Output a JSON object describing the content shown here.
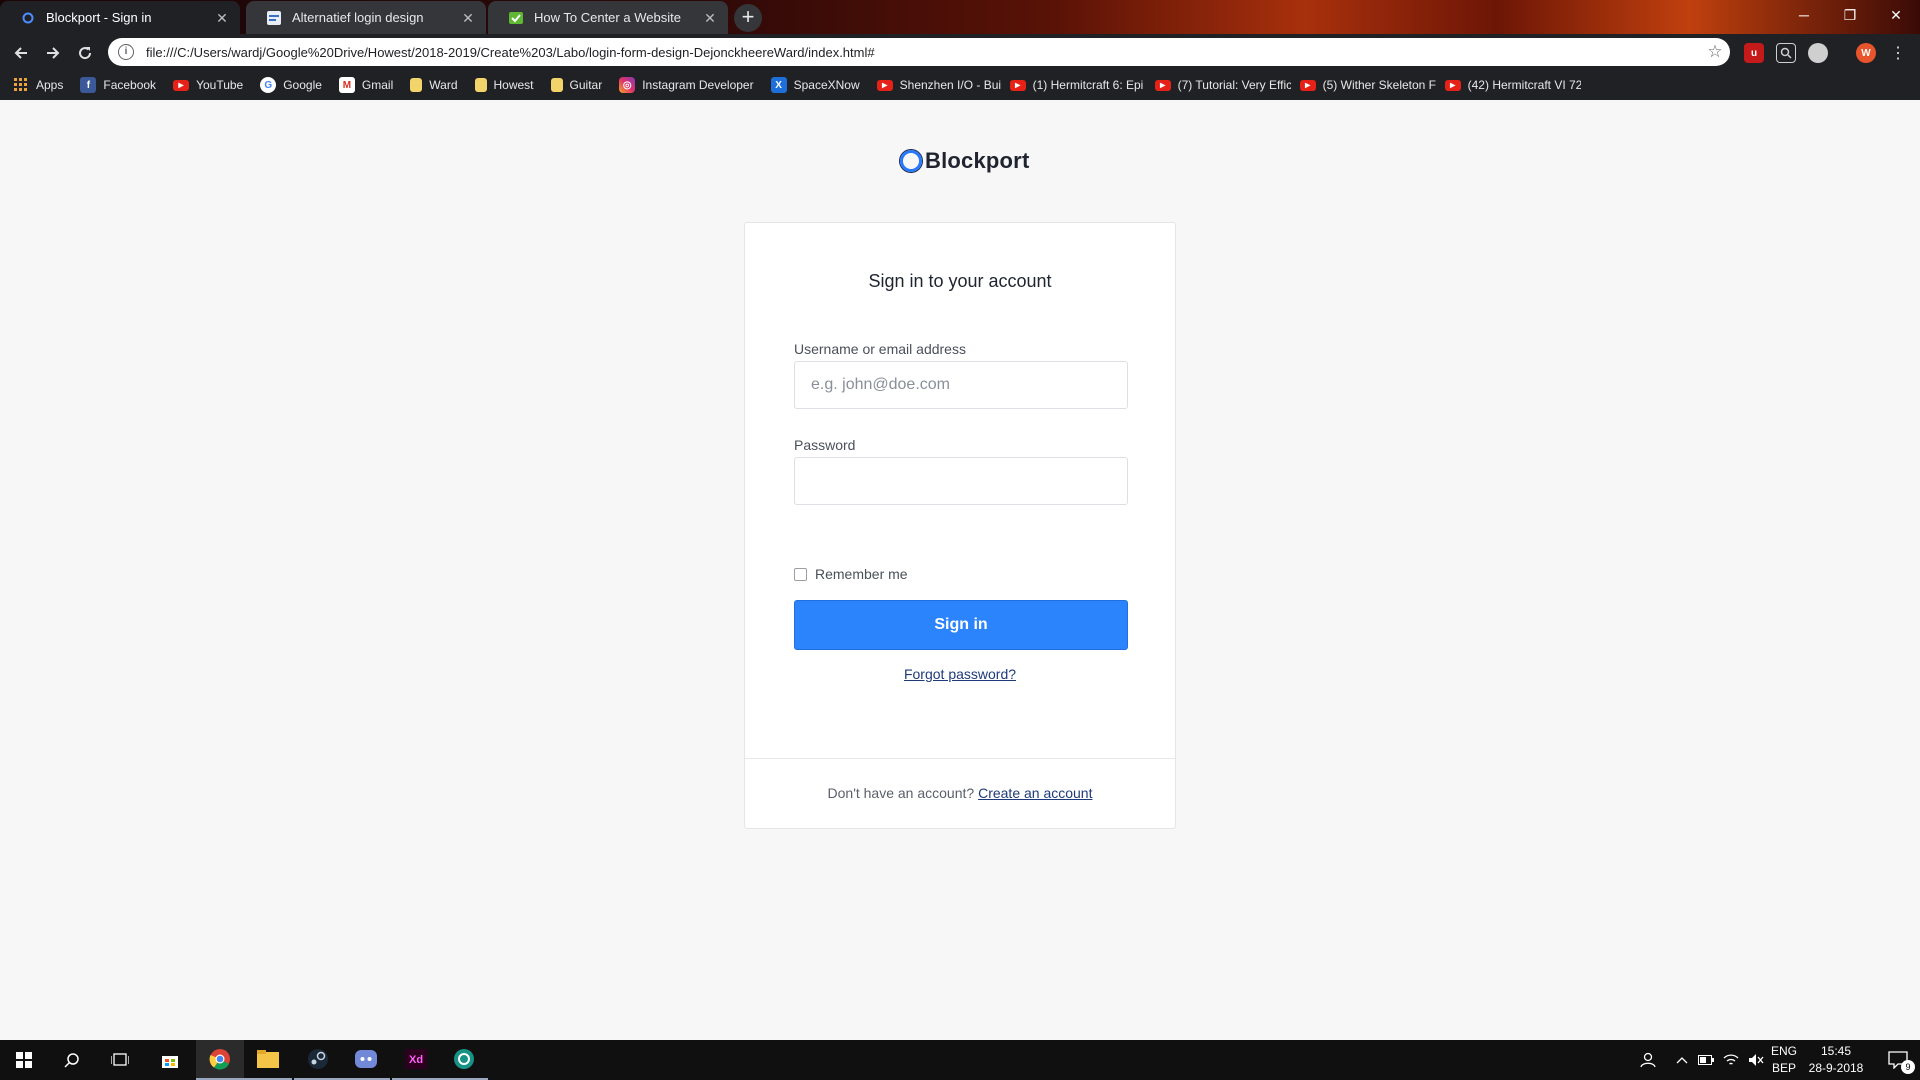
{
  "browser": {
    "tabs": [
      {
        "title": "Blockport - Sign in",
        "active": true
      },
      {
        "title": "Alternatief login design",
        "active": false
      },
      {
        "title": "How To Center a Website",
        "active": false
      }
    ],
    "url": "file:///C:/Users/wardj/Google%20Drive/Howest/2018-2019/Create%203/Labo/login-form-design-DejonckheereWard/index.html#",
    "bookmarks": [
      {
        "label": "Apps",
        "icon": "apps-grid-icon"
      },
      {
        "label": "Facebook",
        "icon": "facebook-icon"
      },
      {
        "label": "YouTube",
        "icon": "youtube-icon"
      },
      {
        "label": "Google",
        "icon": "google-icon"
      },
      {
        "label": "Gmail",
        "icon": "gmail-icon"
      },
      {
        "label": "Ward",
        "icon": "folder-icon"
      },
      {
        "label": "Howest",
        "icon": "folder-icon"
      },
      {
        "label": "Guitar",
        "icon": "folder-icon"
      },
      {
        "label": "Instagram Developer",
        "icon": "instagram-icon"
      },
      {
        "label": "SpaceXNow",
        "icon": "spacex-icon"
      },
      {
        "label": "Shenzhen I/O - Build",
        "icon": "youtube-icon"
      },
      {
        "label": "(1) Hermitcraft 6: Epi",
        "icon": "youtube-icon"
      },
      {
        "label": "(7) Tutorial: Very Effic",
        "icon": "youtube-icon"
      },
      {
        "label": "(5) Wither Skeleton F",
        "icon": "youtube-icon"
      },
      {
        "label": "(42) Hermitcraft VI 72",
        "icon": "youtube-icon"
      }
    ],
    "profile_initial": "W"
  },
  "login": {
    "brand": "Blockport",
    "heading": "Sign in to your account",
    "username_label": "Username or email address",
    "username_placeholder": "e.g. john@doe.com",
    "password_label": "Password",
    "remember_label": "Remember me",
    "signin_label": "Sign in",
    "forgot_label": "Forgot password?",
    "no_account_text": "Don't have an account?",
    "create_account_label": "Create an account"
  },
  "taskbar": {
    "lang_top": "ENG",
    "lang_bottom": "BEP",
    "time": "15:45",
    "date": "28-9-2018",
    "notifications": "9"
  },
  "colors": {
    "accent": "#2c84fc",
    "page_bg": "#f7f7f8",
    "link": "#1f3a7a"
  }
}
